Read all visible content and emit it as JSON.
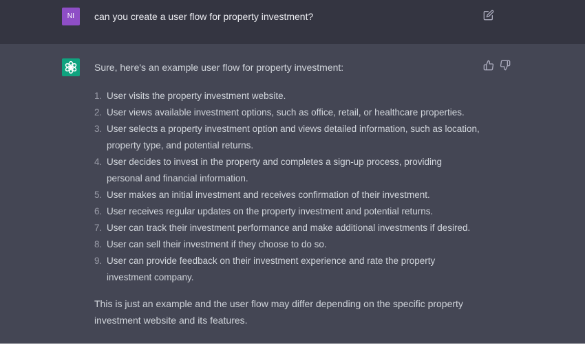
{
  "user_message": {
    "avatar_initials": "NI",
    "text": "can you create a user flow for property investment?"
  },
  "assistant_message": {
    "intro": "Sure, here's an example user flow for property investment:",
    "steps": [
      {
        "num": "1.",
        "text": "User visits the property investment website."
      },
      {
        "num": "2.",
        "text": "User views available investment options, such as office, retail, or healthcare properties."
      },
      {
        "num": "3.",
        "text": "User selects a property investment option and views detailed information, such as location, property type, and potential returns."
      },
      {
        "num": "4.",
        "text": "User decides to invest in the property and completes a sign-up process, providing personal and financial information."
      },
      {
        "num": "5.",
        "text": "User makes an initial investment and receives confirmation of their investment."
      },
      {
        "num": "6.",
        "text": "User receives regular updates on the property investment and potential returns."
      },
      {
        "num": "7.",
        "text": "User can track their investment performance and make additional investments if desired."
      },
      {
        "num": "8.",
        "text": "User can sell their investment if they choose to do so."
      },
      {
        "num": "9.",
        "text": "User can provide feedback on their investment experience and rate the property investment company."
      }
    ],
    "closing": "This is just an example and the user flow may differ depending on the specific property investment website and its features."
  },
  "icons": {
    "edit": "edit-icon",
    "thumbs_up": "thumbs-up-icon",
    "thumbs_down": "thumbs-down-icon",
    "assistant_logo": "chatgpt-logo-icon"
  },
  "colors": {
    "user_row_bg": "#343541",
    "assistant_row_bg": "#444654",
    "user_avatar": "#8e4ec6",
    "assistant_avatar": "#10a37f",
    "text": "#d1d5db"
  }
}
